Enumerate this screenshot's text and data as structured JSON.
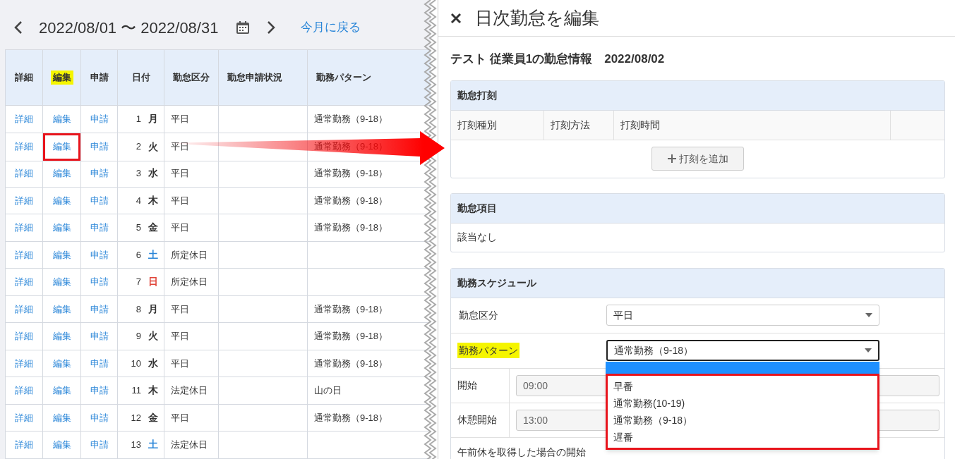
{
  "period": {
    "range": "2022/08/01 〜 2022/08/31",
    "today_link": "今月に戻る"
  },
  "table": {
    "columns": [
      {
        "label": "詳細",
        "highlighted": false
      },
      {
        "label": "編集",
        "highlighted": true
      },
      {
        "label": "申請",
        "highlighted": false
      },
      {
        "label": "日付",
        "highlighted": false
      },
      {
        "label": "勤怠区分",
        "highlighted": false
      },
      {
        "label": "勤怠申請状況",
        "highlighted": false
      },
      {
        "label": "勤務パターン",
        "highlighted": false
      }
    ],
    "rows": [
      {
        "detail": "詳細",
        "edit": "編集",
        "edit_marked": false,
        "apply": "申請",
        "day": "1",
        "weekday": "月",
        "color": "#333333",
        "category": "平日",
        "pattern": "通常勤務（9-18）"
      },
      {
        "detail": "詳細",
        "edit": "編集",
        "edit_marked": true,
        "apply": "申請",
        "day": "2",
        "weekday": "火",
        "color": "#333333",
        "category": "平日",
        "pattern": "通常勤務（9-18）"
      },
      {
        "detail": "詳細",
        "edit": "編集",
        "edit_marked": false,
        "apply": "申請",
        "day": "3",
        "weekday": "水",
        "color": "#333333",
        "category": "平日",
        "pattern": "通常勤務（9-18）"
      },
      {
        "detail": "詳細",
        "edit": "編集",
        "edit_marked": false,
        "apply": "申請",
        "day": "4",
        "weekday": "木",
        "color": "#333333",
        "category": "平日",
        "pattern": "通常勤務（9-18）"
      },
      {
        "detail": "詳細",
        "edit": "編集",
        "edit_marked": false,
        "apply": "申請",
        "day": "5",
        "weekday": "金",
        "color": "#333333",
        "category": "平日",
        "pattern": "通常勤務（9-18）"
      },
      {
        "detail": "詳細",
        "edit": "編集",
        "edit_marked": false,
        "apply": "申請",
        "day": "6",
        "weekday": "土",
        "color": "#2a86d8",
        "category": "所定休日"
      },
      {
        "detail": "詳細",
        "edit": "編集",
        "edit_marked": false,
        "apply": "申請",
        "day": "7",
        "weekday": "日",
        "color": "#e0453a",
        "category": "所定休日"
      },
      {
        "detail": "詳細",
        "edit": "編集",
        "edit_marked": false,
        "apply": "申請",
        "day": "8",
        "weekday": "月",
        "color": "#333333",
        "category": "平日",
        "pattern": "通常勤務（9-18）"
      },
      {
        "detail": "詳細",
        "edit": "編集",
        "edit_marked": false,
        "apply": "申請",
        "day": "9",
        "weekday": "火",
        "color": "#333333",
        "category": "平日",
        "pattern": "通常勤務（9-18）"
      },
      {
        "detail": "詳細",
        "edit": "編集",
        "edit_marked": false,
        "apply": "申請",
        "day": "10",
        "weekday": "水",
        "color": "#333333",
        "category": "平日",
        "pattern": "通常勤務（9-18）"
      },
      {
        "detail": "詳細",
        "edit": "編集",
        "edit_marked": false,
        "apply": "申請",
        "day": "11",
        "weekday": "木",
        "color": "#333333",
        "category": "法定休日",
        "pattern": "山の日"
      },
      {
        "detail": "詳細",
        "edit": "編集",
        "edit_marked": false,
        "apply": "申請",
        "day": "12",
        "weekday": "金",
        "color": "#333333",
        "category": "平日",
        "pattern": "通常勤務（9-18）"
      },
      {
        "detail": "詳細",
        "edit": "編集",
        "edit_marked": false,
        "apply": "申請",
        "day": "13",
        "weekday": "土",
        "color": "#2a86d8",
        "category": "法定休日"
      }
    ]
  },
  "annotation_arrow": true,
  "panel": {
    "title": "日次勤怠を編集",
    "heading": "テスト 従業員1の勤怠情報　2022/08/02",
    "punch": {
      "title": "勤怠打刻",
      "columns": [
        "打刻種別",
        "打刻方法",
        "打刻時間"
      ],
      "add_button": "打刻を追加"
    },
    "items": {
      "title": "勤怠項目",
      "text": "該当なし"
    },
    "schedule": {
      "title": "勤務スケジュール",
      "selects": [
        {
          "label": "勤怠区分",
          "value": "平日",
          "highlighted": false,
          "open": false
        },
        {
          "label": "勤務パターン",
          "value": "通常勤務（9-18）",
          "highlighted": true,
          "open": true,
          "marked": true,
          "options": [
            "早番",
            "通常勤務(10-19)",
            "通常勤務（9-18）",
            "遅番"
          ]
        }
      ],
      "times": [
        {
          "label": "開始",
          "value": "09:00"
        },
        {
          "label": "休憩開始",
          "value": "13:00"
        }
      ],
      "cut_label": "午前休を取得した場合の開始"
    }
  }
}
